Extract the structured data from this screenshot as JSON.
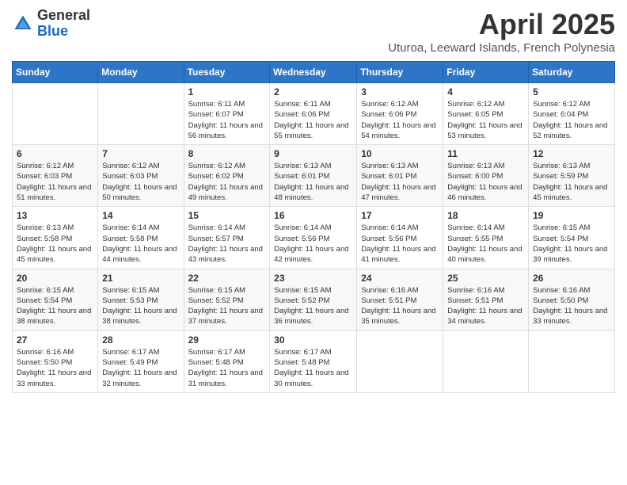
{
  "logo": {
    "general": "General",
    "blue": "Blue"
  },
  "header": {
    "month": "April 2025",
    "location": "Uturoa, Leeward Islands, French Polynesia"
  },
  "weekdays": [
    "Sunday",
    "Monday",
    "Tuesday",
    "Wednesday",
    "Thursday",
    "Friday",
    "Saturday"
  ],
  "weeks": [
    [
      null,
      null,
      {
        "day": 1,
        "sunrise": "6:11 AM",
        "sunset": "6:07 PM",
        "daylight": "11 hours and 56 minutes."
      },
      {
        "day": 2,
        "sunrise": "6:11 AM",
        "sunset": "6:06 PM",
        "daylight": "11 hours and 55 minutes."
      },
      {
        "day": 3,
        "sunrise": "6:12 AM",
        "sunset": "6:06 PM",
        "daylight": "11 hours and 54 minutes."
      },
      {
        "day": 4,
        "sunrise": "6:12 AM",
        "sunset": "6:05 PM",
        "daylight": "11 hours and 53 minutes."
      },
      {
        "day": 5,
        "sunrise": "6:12 AM",
        "sunset": "6:04 PM",
        "daylight": "11 hours and 52 minutes."
      }
    ],
    [
      {
        "day": 6,
        "sunrise": "6:12 AM",
        "sunset": "6:03 PM",
        "daylight": "11 hours and 51 minutes."
      },
      {
        "day": 7,
        "sunrise": "6:12 AM",
        "sunset": "6:03 PM",
        "daylight": "11 hours and 50 minutes."
      },
      {
        "day": 8,
        "sunrise": "6:12 AM",
        "sunset": "6:02 PM",
        "daylight": "11 hours and 49 minutes."
      },
      {
        "day": 9,
        "sunrise": "6:13 AM",
        "sunset": "6:01 PM",
        "daylight": "11 hours and 48 minutes."
      },
      {
        "day": 10,
        "sunrise": "6:13 AM",
        "sunset": "6:01 PM",
        "daylight": "11 hours and 47 minutes."
      },
      {
        "day": 11,
        "sunrise": "6:13 AM",
        "sunset": "6:00 PM",
        "daylight": "11 hours and 46 minutes."
      },
      {
        "day": 12,
        "sunrise": "6:13 AM",
        "sunset": "5:59 PM",
        "daylight": "11 hours and 45 minutes."
      }
    ],
    [
      {
        "day": 13,
        "sunrise": "6:13 AM",
        "sunset": "5:58 PM",
        "daylight": "11 hours and 45 minutes."
      },
      {
        "day": 14,
        "sunrise": "6:14 AM",
        "sunset": "5:58 PM",
        "daylight": "11 hours and 44 minutes."
      },
      {
        "day": 15,
        "sunrise": "6:14 AM",
        "sunset": "5:57 PM",
        "daylight": "11 hours and 43 minutes."
      },
      {
        "day": 16,
        "sunrise": "6:14 AM",
        "sunset": "5:56 PM",
        "daylight": "11 hours and 42 minutes."
      },
      {
        "day": 17,
        "sunrise": "6:14 AM",
        "sunset": "5:56 PM",
        "daylight": "11 hours and 41 minutes."
      },
      {
        "day": 18,
        "sunrise": "6:14 AM",
        "sunset": "5:55 PM",
        "daylight": "11 hours and 40 minutes."
      },
      {
        "day": 19,
        "sunrise": "6:15 AM",
        "sunset": "5:54 PM",
        "daylight": "11 hours and 39 minutes."
      }
    ],
    [
      {
        "day": 20,
        "sunrise": "6:15 AM",
        "sunset": "5:54 PM",
        "daylight": "11 hours and 38 minutes."
      },
      {
        "day": 21,
        "sunrise": "6:15 AM",
        "sunset": "5:53 PM",
        "daylight": "11 hours and 38 minutes."
      },
      {
        "day": 22,
        "sunrise": "6:15 AM",
        "sunset": "5:52 PM",
        "daylight": "11 hours and 37 minutes."
      },
      {
        "day": 23,
        "sunrise": "6:15 AM",
        "sunset": "5:52 PM",
        "daylight": "11 hours and 36 minutes."
      },
      {
        "day": 24,
        "sunrise": "6:16 AM",
        "sunset": "5:51 PM",
        "daylight": "11 hours and 35 minutes."
      },
      {
        "day": 25,
        "sunrise": "6:16 AM",
        "sunset": "5:51 PM",
        "daylight": "11 hours and 34 minutes."
      },
      {
        "day": 26,
        "sunrise": "6:16 AM",
        "sunset": "5:50 PM",
        "daylight": "11 hours and 33 minutes."
      }
    ],
    [
      {
        "day": 27,
        "sunrise": "6:16 AM",
        "sunset": "5:50 PM",
        "daylight": "11 hours and 33 minutes."
      },
      {
        "day": 28,
        "sunrise": "6:17 AM",
        "sunset": "5:49 PM",
        "daylight": "11 hours and 32 minutes."
      },
      {
        "day": 29,
        "sunrise": "6:17 AM",
        "sunset": "5:48 PM",
        "daylight": "11 hours and 31 minutes."
      },
      {
        "day": 30,
        "sunrise": "6:17 AM",
        "sunset": "5:48 PM",
        "daylight": "11 hours and 30 minutes."
      },
      null,
      null,
      null
    ]
  ]
}
